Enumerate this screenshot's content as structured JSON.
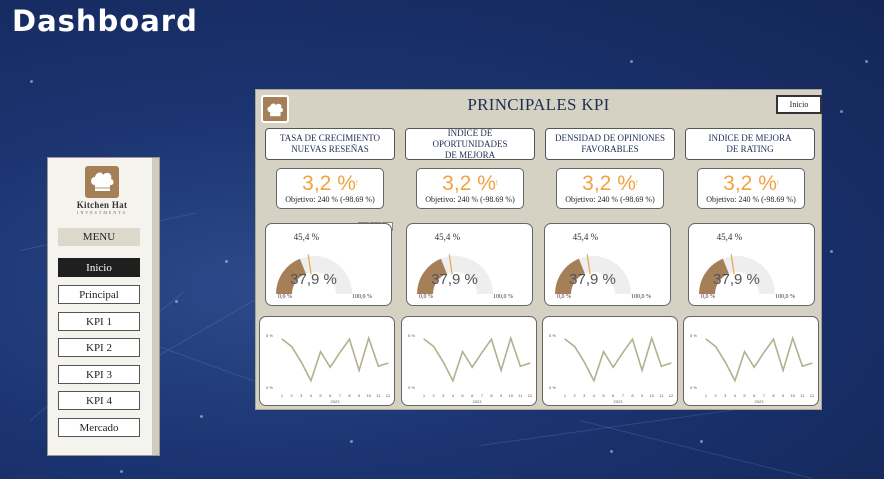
{
  "page": {
    "title": "Dashboard"
  },
  "sidebar": {
    "logo": {
      "name": "Kitchen Hat",
      "sub": "INVESTMENTS"
    },
    "menu_label": "MENU",
    "items": [
      {
        "label": "Inicio",
        "active": true
      },
      {
        "label": "Principal",
        "active": false
      },
      {
        "label": "KPI 1",
        "active": false
      },
      {
        "label": "KPI 2",
        "active": false
      },
      {
        "label": "KPI 3",
        "active": false
      },
      {
        "label": "KPI 4",
        "active": false
      },
      {
        "label": "Mercado",
        "active": false
      }
    ]
  },
  "report": {
    "title": "PRINCIPALES KPI",
    "inicio_button": "Inicio",
    "toolbar_icons": [
      "filter-icon",
      "focus-mode-icon",
      "more-options-icon"
    ],
    "kpis": [
      {
        "header": "TASA DE CRECIMIENTO\nNUEVAS RESEÑAS",
        "value": "3,2 %",
        "mark": "!",
        "objective": "Objetivo: 240 % (-98.69 %)",
        "gauge": {
          "target_label": "45,4 %",
          "value_label": "37,9 %",
          "min_label": "0,0 %",
          "max_label": "100,0 %",
          "value": 37.9,
          "target": 45.4,
          "min": 0,
          "max": 100
        }
      },
      {
        "header": "INDICE DE OPORTUNIDADES\nDE MEJORA",
        "value": "3,2 %",
        "mark": "!",
        "objective": "Objetivo: 240 % (-98.69 %)",
        "gauge": {
          "target_label": "45,4 %",
          "value_label": "37,9 %",
          "min_label": "0,0 %",
          "max_label": "100,0 %",
          "value": 37.9,
          "target": 45.4,
          "min": 0,
          "max": 100
        }
      },
      {
        "header": "DENSIDAD DE OPINIONES\nFAVORABLES",
        "value": "3,2 %",
        "mark": "!",
        "objective": "Objetivo: 240 % (-98.69 %)",
        "gauge": {
          "target_label": "45,4 %",
          "value_label": "37,9 %",
          "min_label": "0,0 %",
          "max_label": "100,0 %",
          "value": 37.9,
          "target": 45.4,
          "min": 0,
          "max": 100
        }
      },
      {
        "header": "INDICE DE MEJORA\nDE RATING",
        "value": "3,2 %",
        "mark": "!",
        "objective": "Objetivo: 240 % (-98.69 %)",
        "gauge": {
          "target_label": "45,4 %",
          "value_label": "37,9 %",
          "min_label": "0,0 %",
          "max_label": "100,0 %",
          "value": 37.9,
          "target": 45.4,
          "min": 0,
          "max": 100
        }
      }
    ]
  },
  "chart_data": [
    {
      "type": "line",
      "x": [
        1,
        2,
        3,
        4,
        5,
        6,
        7,
        8,
        9,
        10,
        11,
        12
      ],
      "xlabel": "2023",
      "ylabel_ticks": [
        "5 %",
        "0 %"
      ],
      "ylim": [
        0,
        5
      ],
      "series": [
        {
          "values": [
            4.6,
            3.9,
            2.4,
            0.6,
            3.4,
            1.9,
            3.3,
            4.6,
            1.6,
            4.7,
            2.0,
            2.3
          ]
        }
      ]
    },
    {
      "type": "line",
      "x": [
        1,
        2,
        3,
        4,
        5,
        6,
        7,
        8,
        9,
        10,
        11,
        12
      ],
      "xlabel": "2023",
      "ylabel_ticks": [
        "5 %",
        "0 %"
      ],
      "ylim": [
        0,
        5
      ],
      "series": [
        {
          "values": [
            4.6,
            3.9,
            2.4,
            0.6,
            3.4,
            1.9,
            3.3,
            4.6,
            1.6,
            4.7,
            2.0,
            2.3
          ]
        }
      ]
    },
    {
      "type": "line",
      "x": [
        1,
        2,
        3,
        4,
        5,
        6,
        7,
        8,
        9,
        10,
        11,
        12
      ],
      "xlabel": "2023",
      "ylabel_ticks": [
        "5 %",
        "0 %"
      ],
      "ylim": [
        0,
        5
      ],
      "series": [
        {
          "values": [
            4.6,
            3.9,
            2.4,
            0.6,
            3.4,
            1.9,
            3.3,
            4.6,
            1.6,
            4.7,
            2.0,
            2.3
          ]
        }
      ]
    },
    {
      "type": "line",
      "x": [
        1,
        2,
        3,
        4,
        5,
        6,
        7,
        8,
        9,
        10,
        11,
        12
      ],
      "xlabel": "2023",
      "ylabel_ticks": [
        "5 %",
        "0 %"
      ],
      "ylim": [
        0,
        5
      ],
      "series": [
        {
          "values": [
            4.6,
            3.9,
            2.4,
            0.6,
            3.4,
            1.9,
            3.3,
            4.6,
            1.6,
            4.7,
            2.0,
            2.3
          ]
        }
      ]
    }
  ],
  "colors": {
    "accent": "#f0a340",
    "gauge_fill": "#a47f57",
    "gauge_track": "#eeeeee",
    "target_mark": "#f0a340",
    "line": "#b3b08f",
    "panel_bg": "#d6d2c3",
    "title": "#1e2e55"
  }
}
